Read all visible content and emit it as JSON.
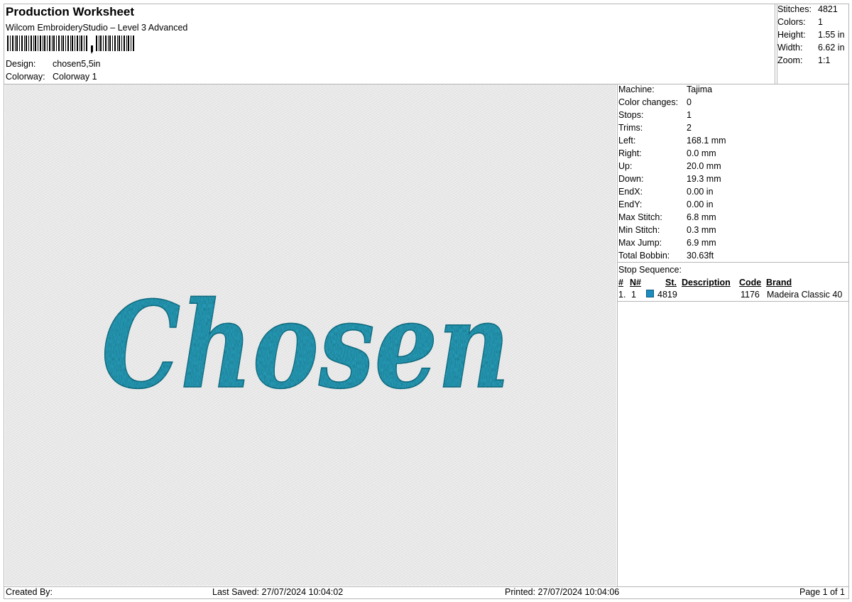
{
  "header": {
    "title": "Production Worksheet",
    "software": "Wilcom EmbroideryStudio – Level 3 Advanced",
    "design_label": "Design:",
    "design_value": "chosen5,5in",
    "colorway_label": "Colorway:",
    "colorway_value": "Colorway 1"
  },
  "summary": [
    {
      "label": "Stitches:",
      "value": "4821"
    },
    {
      "label": "Colors:",
      "value": "1"
    },
    {
      "label": "Height:",
      "value": "1.55 in"
    },
    {
      "label": "Width:",
      "value": "6.62 in"
    },
    {
      "label": "Zoom:",
      "value": "1:1"
    }
  ],
  "details": [
    {
      "label": "Machine:",
      "value": "Tajima"
    },
    {
      "label": "Color changes:",
      "value": "0"
    },
    {
      "label": "Stops:",
      "value": "1"
    },
    {
      "label": "Trims:",
      "value": "2"
    },
    {
      "label": "Left:",
      "value": "168.1 mm"
    },
    {
      "label": "Right:",
      "value": "0.0 mm"
    },
    {
      "label": "Up:",
      "value": "20.0 mm"
    },
    {
      "label": "Down:",
      "value": "19.3 mm"
    },
    {
      "label": "EndX:",
      "value": "0.00 in"
    },
    {
      "label": "EndY:",
      "value": "0.00 in"
    },
    {
      "label": "Max Stitch:",
      "value": "6.8 mm"
    },
    {
      "label": "Min Stitch:",
      "value": "0.3 mm"
    },
    {
      "label": "Max Jump:",
      "value": "6.9 mm"
    },
    {
      "label": "Total Bobbin:",
      "value": "30.63ft"
    }
  ],
  "stop_sequence": {
    "title": "Stop Sequence:",
    "columns": [
      "#",
      "N#",
      "St.",
      "Description",
      "Code",
      "Brand"
    ],
    "rows": [
      {
        "index": "1.",
        "n": "1",
        "stitches": "4819",
        "description": "",
        "code": "1176",
        "brand": "Madeira Classic 40",
        "color": "#1a8cc0"
      }
    ]
  },
  "design_text": "Chosen",
  "thread_color": "#2aa3c0",
  "footer": {
    "created_by": "Created By:",
    "last_saved": "Last Saved: 27/07/2024 10:04:02",
    "printed": "Printed: 27/07/2024 10:04:06",
    "page": "Page 1 of 1"
  }
}
